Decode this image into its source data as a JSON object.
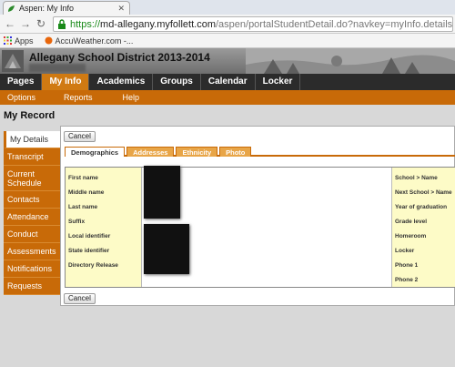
{
  "browser": {
    "tab_title": "Aspen: My Info",
    "url_scheme": "https://",
    "url_host": "md-allegany.myfollett.com",
    "url_rest": "/aspen/portalStudentDetail.do?navkey=myInfo.details.detail",
    "bookmarks": [
      "Apps",
      "AccuWeather.com -..."
    ]
  },
  "header": {
    "district": "Allegany School District 2013-2014"
  },
  "mainnav": [
    "Pages",
    "My Info",
    "Academics",
    "Groups",
    "Calendar",
    "Locker"
  ],
  "mainnav_active": "My Info",
  "subnav": [
    "Options",
    "Reports",
    "Help"
  ],
  "page_title": "My Record",
  "sidemenu": [
    "My Details",
    "Transcript",
    "Current Schedule",
    "Contacts",
    "Attendance",
    "Conduct",
    "Assessments",
    "Notifications",
    "Requests"
  ],
  "sidemenu_active": "My Details",
  "buttons": {
    "cancel_top": "Cancel",
    "cancel_bottom": "Cancel"
  },
  "subtabs": [
    "Demographics",
    "Addresses",
    "Ethnicity",
    "Photo"
  ],
  "subtabs_active": "Demographics",
  "fields_left": [
    "First name",
    "Middle name",
    "Last name",
    "Suffix",
    "Local identifier",
    "State identifier",
    "Directory Release"
  ],
  "fields_right": [
    "School > Name",
    "Next School > Name",
    "Year of graduation",
    "Grade level",
    "Homeroom",
    "Locker",
    "Phone 1",
    "Phone 2"
  ],
  "colors": {
    "accent": "#c86a08",
    "nav_bg": "#2b2b2b",
    "label_bg": "#fdfbc7"
  }
}
